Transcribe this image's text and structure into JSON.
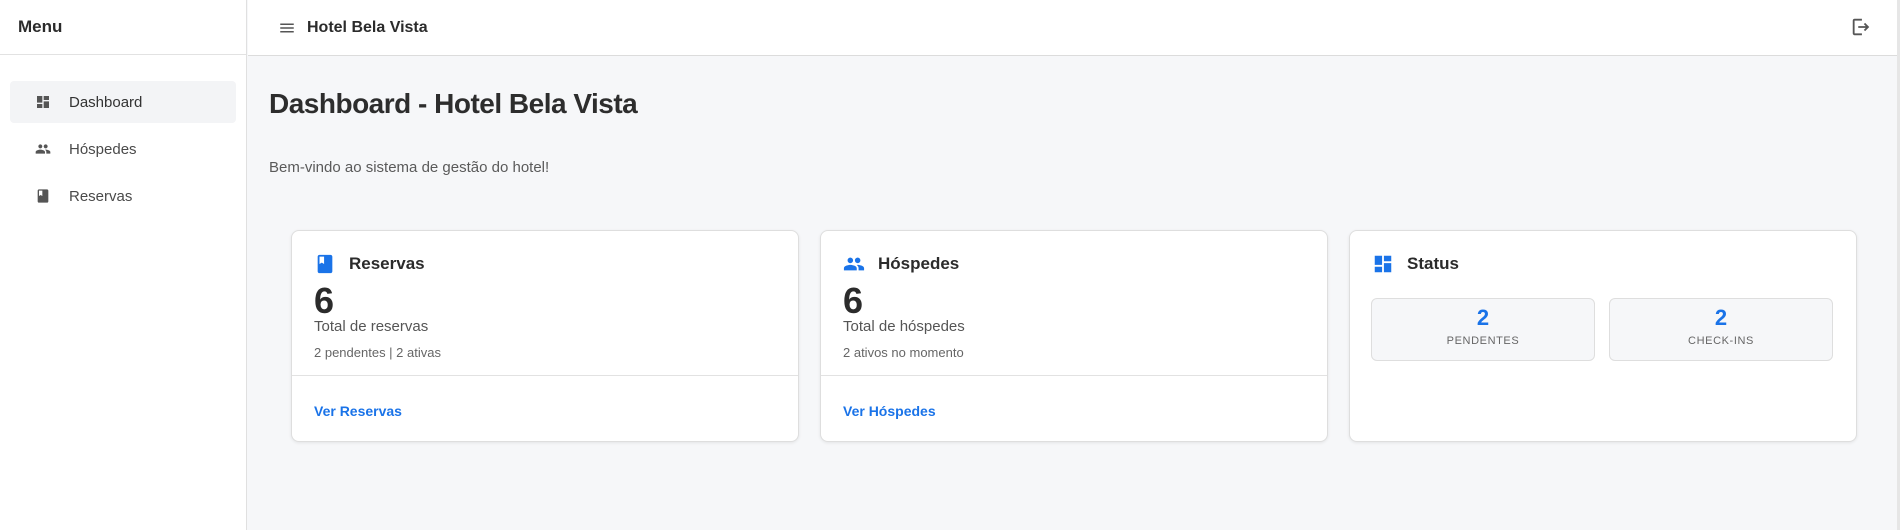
{
  "sidebar": {
    "title": "Menu",
    "items": [
      {
        "label": "Dashboard",
        "icon": "dashboard-icon",
        "active": true
      },
      {
        "label": "Hóspedes",
        "icon": "people-icon",
        "active": false
      },
      {
        "label": "Reservas",
        "icon": "book-icon",
        "active": false
      }
    ]
  },
  "header": {
    "title": "Hotel Bela Vista"
  },
  "main": {
    "title": "Dashboard - Hotel Bela Vista",
    "subtitle": "Bem-vindo ao sistema de gestão do hotel!"
  },
  "cards": {
    "reservas": {
      "title": "Reservas",
      "value": "6",
      "label": "Total de reservas",
      "detail": "2 pendentes | 2 ativas",
      "link": "Ver Reservas"
    },
    "hospedes": {
      "title": "Hóspedes",
      "value": "6",
      "label": "Total de hóspedes",
      "detail": "2 ativos no momento",
      "link": "Ver Hóspedes"
    },
    "status": {
      "title": "Status",
      "stats": [
        {
          "value": "2",
          "label": "PENDENTES"
        },
        {
          "value": "2",
          "label": "CHECK-INS"
        }
      ]
    }
  },
  "colors": {
    "accent": "#1a73e8",
    "background": "#f6f7f9"
  }
}
